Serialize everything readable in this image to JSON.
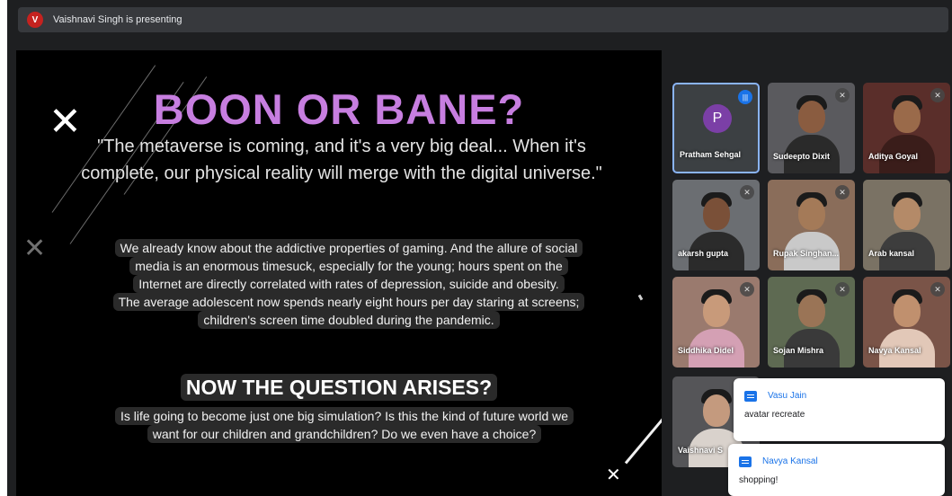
{
  "presenter": {
    "avatar_letter": "V",
    "banner": "Vaishnavi Singh is presenting"
  },
  "slide": {
    "title": "BOON OR BANE?",
    "quote": "\"The metaverse is coming, and it's a very big deal... When it's complete, our physical reality will merge with the digital universe.\"",
    "para_lines": [
      "We already know about the addictive properties of gaming. And the allure of social",
      "media is an enormous timesuck, especially for the young; hours spent on the",
      "Internet are directly correlated with rates of depression, suicide and obesity.",
      "The average adolescent now spends nearly eight hours per day staring at screens;",
      "children's screen time doubled during the pandemic."
    ],
    "question_title": "NOW THE QUESTION ARISES?",
    "question_lines": [
      "Is life going to become just one big simulation? Is this the kind of future world we",
      "want for our children and grandchildren? Do we even have a choice?"
    ],
    "deco_x": "✕"
  },
  "participants": [
    {
      "name": "Pratham Sehgal",
      "initial": "P"
    },
    {
      "name": "Sudeepto Dixit"
    },
    {
      "name": "Aditya Goyal"
    },
    {
      "name": "akarsh gupta"
    },
    {
      "name": "Rupak Singhan..."
    },
    {
      "name": "Arab kansal"
    },
    {
      "name": "Siddhika Didel"
    },
    {
      "name": "Sojan Mishra"
    },
    {
      "name": "Navya Kansal"
    },
    {
      "name": "Vaishnavi S"
    }
  ],
  "chat": [
    {
      "sender": "Vasu Jain",
      "message": "avatar recreate"
    },
    {
      "sender": "Navya Kansal",
      "message": "shopping!"
    }
  ],
  "icons": {
    "mic_off": "✕",
    "speaking": "|||"
  },
  "colors": {
    "title": "#c77ee0",
    "active_border": "#8ab4f8",
    "presenter_avatar": "#c5221f",
    "chat_accent": "#1a73e8"
  }
}
